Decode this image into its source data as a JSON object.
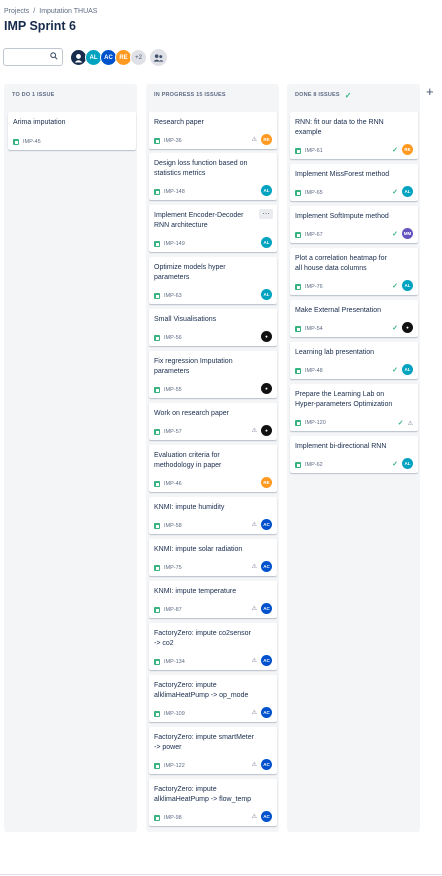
{
  "breadcrumb": {
    "projects": "Projects",
    "separator": "/",
    "project": "Imputation THUAS"
  },
  "page_title": "IMP Sprint 6",
  "search": {
    "value": "",
    "placeholder": ""
  },
  "avatars": [
    {
      "initials": "",
      "color": "#172b4d"
    },
    {
      "initials": "AL",
      "color": "#00a3bf"
    },
    {
      "initials": "AC",
      "color": "#0052cc"
    },
    {
      "initials": "RE",
      "color": "#ff991f"
    }
  ],
  "avatars_more": "+2",
  "colors": {
    "green": "#36b37e",
    "teal": "#00a3bf",
    "blue": "#0052cc",
    "orange": "#ff991f",
    "purple": "#6554c0",
    "dark": "#172b4d"
  },
  "columns": {
    "todo": {
      "title": "TO DO 1 ISSUE"
    },
    "progress": {
      "title": "IN PROGRESS 15 ISSUES"
    },
    "done": {
      "title": "DONE 8 ISSUES"
    }
  },
  "cards": {
    "todo": [
      {
        "title": "Arima imputation",
        "key": "IMP-45"
      }
    ],
    "progress": [
      {
        "title": "Research paper",
        "key": "IMP-36",
        "avatar": "RE"
      },
      {
        "title": "Design loss function based on statistics metrics",
        "key": "IMP-148",
        "avatar": "AL"
      },
      {
        "title": "Implement Encoder-Decoder RNN architecture",
        "key": "IMP-149",
        "avatar": "AL"
      },
      {
        "title": "Optimize models hyper parameters",
        "key": "IMP-63",
        "avatar": "AL"
      },
      {
        "title": "Small Visualisations",
        "key": "IMP-56",
        "avatar": ""
      },
      {
        "title": "Fix regression Imputation parameters",
        "key": "IMP-55",
        "avatar": ""
      },
      {
        "title": "Work on research paper",
        "key": "IMP-57",
        "avatar": ""
      },
      {
        "title": "Evaluation criteria for methodology in paper",
        "key": "IMP-46",
        "avatar": "RE"
      },
      {
        "title": "KNMI: impute humidity",
        "key": "IMP-58",
        "avatar": "AC"
      },
      {
        "title": "KNMI: impute solar radiation",
        "key": "IMP-75",
        "avatar": "AC"
      },
      {
        "title": "KNMI: impute temperature",
        "key": "IMP-87",
        "avatar": "AC"
      },
      {
        "title": "FactoryZero: impute co2sensor -> co2",
        "key": "IMP-134",
        "avatar": "AC"
      },
      {
        "title": "FactoryZero: impute alklimaHeatPump -> op_mode",
        "key": "IMP-109",
        "avatar": "AC"
      },
      {
        "title": "FactoryZero: impute smartMeter -> power",
        "key": "IMP-122",
        "avatar": "AC"
      },
      {
        "title": "FactoryZero: impute alklimaHeatPump -> flow_temp",
        "key": "IMP-98",
        "avatar": "AC"
      }
    ],
    "done": [
      {
        "title": "RNN: fit our data to the RNN example",
        "key": "IMP-61",
        "avatar": "RE"
      },
      {
        "title": "Implement MissForest method",
        "key": "IMP-65",
        "avatar": "AL"
      },
      {
        "title": "Implement SoftImpute method",
        "key": "IMP-67",
        "avatar": "MM"
      },
      {
        "title": "Plot a correlation heatmap for all house data columns",
        "key": "IMP-76",
        "avatar": "AL"
      },
      {
        "title": "Make External Presentation",
        "key": "IMP-54",
        "avatar": ""
      },
      {
        "title": "Learning lab presentation",
        "key": "IMP-48",
        "avatar": "AL"
      },
      {
        "title": "Prepare the Learning Lab on Hyper-parameters Optimization",
        "key": "IMP-120",
        "avatar": ""
      },
      {
        "title": "Implement bi-directional RNN",
        "key": "IMP-62",
        "avatar": "AL"
      }
    ]
  }
}
